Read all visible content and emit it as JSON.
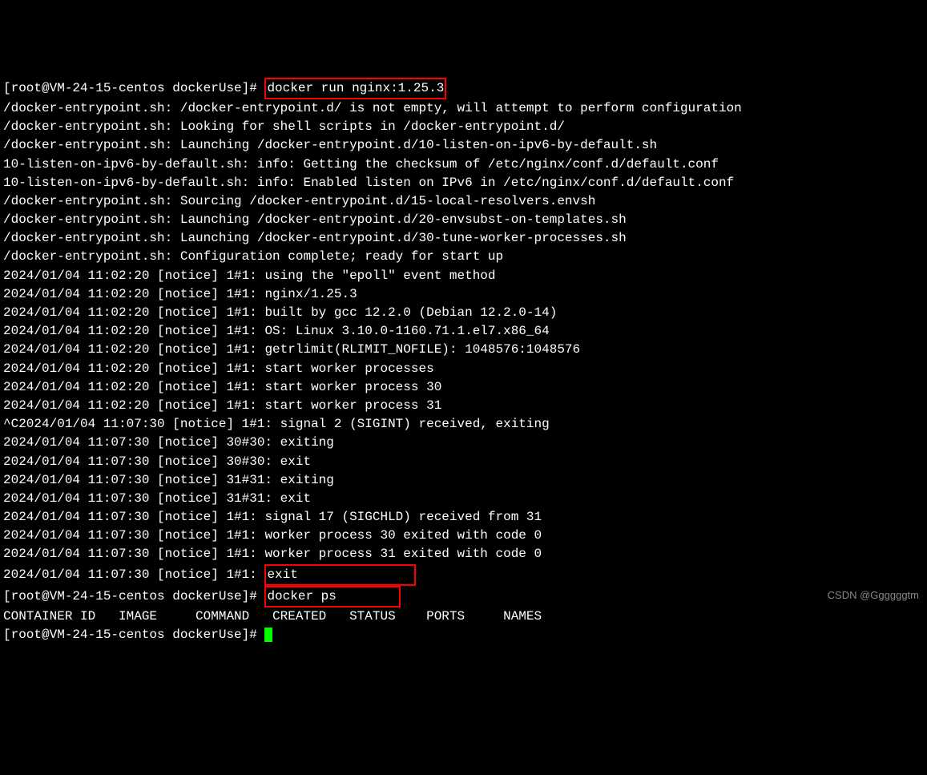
{
  "prompt1": {
    "prefix": "[root@VM-24-15-centos dockerUse]# ",
    "cmd": "docker run nginx:1.25.3"
  },
  "output": [
    "/docker-entrypoint.sh: /docker-entrypoint.d/ is not empty, will attempt to perform configuration",
    "/docker-entrypoint.sh: Looking for shell scripts in /docker-entrypoint.d/",
    "/docker-entrypoint.sh: Launching /docker-entrypoint.d/10-listen-on-ipv6-by-default.sh",
    "10-listen-on-ipv6-by-default.sh: info: Getting the checksum of /etc/nginx/conf.d/default.conf",
    "10-listen-on-ipv6-by-default.sh: info: Enabled listen on IPv6 in /etc/nginx/conf.d/default.conf",
    "/docker-entrypoint.sh: Sourcing /docker-entrypoint.d/15-local-resolvers.envsh",
    "/docker-entrypoint.sh: Launching /docker-entrypoint.d/20-envsubst-on-templates.sh",
    "/docker-entrypoint.sh: Launching /docker-entrypoint.d/30-tune-worker-processes.sh",
    "/docker-entrypoint.sh: Configuration complete; ready for start up",
    "2024/01/04 11:02:20 [notice] 1#1: using the \"epoll\" event method",
    "2024/01/04 11:02:20 [notice] 1#1: nginx/1.25.3",
    "2024/01/04 11:02:20 [notice] 1#1: built by gcc 12.2.0 (Debian 12.2.0-14)",
    "2024/01/04 11:02:20 [notice] 1#1: OS: Linux 3.10.0-1160.71.1.el7.x86_64",
    "2024/01/04 11:02:20 [notice] 1#1: getrlimit(RLIMIT_NOFILE): 1048576:1048576",
    "2024/01/04 11:02:20 [notice] 1#1: start worker processes",
    "2024/01/04 11:02:20 [notice] 1#1: start worker process 30",
    "2024/01/04 11:02:20 [notice] 1#1: start worker process 31",
    "^C2024/01/04 11:07:30 [notice] 1#1: signal 2 (SIGINT) received, exiting",
    "2024/01/04 11:07:30 [notice] 30#30: exiting",
    "2024/01/04 11:07:30 [notice] 30#30: exit",
    "2024/01/04 11:07:30 [notice] 31#31: exiting",
    "2024/01/04 11:07:30 [notice] 31#31: exit",
    "2024/01/04 11:07:30 [notice] 1#1: signal 17 (SIGCHLD) received from 31",
    "2024/01/04 11:07:30 [notice] 1#1: worker process 30 exited with code 0",
    "2024/01/04 11:07:30 [notice] 1#1: worker process 31 exited with code 0"
  ],
  "exit_line": {
    "prefix": "2024/01/04 11:07:30 [notice] 1#1: ",
    "cmd": "exit               "
  },
  "prompt2": {
    "prefix": "[root@VM-24-15-centos dockerUse]# ",
    "cmd": "docker ps        "
  },
  "ps_header": "CONTAINER ID   IMAGE     COMMAND   CREATED   STATUS    PORTS     NAMES",
  "prompt3": {
    "prefix": "[root@VM-24-15-centos dockerUse]# "
  },
  "watermark": "CSDN @Ggggggtm"
}
